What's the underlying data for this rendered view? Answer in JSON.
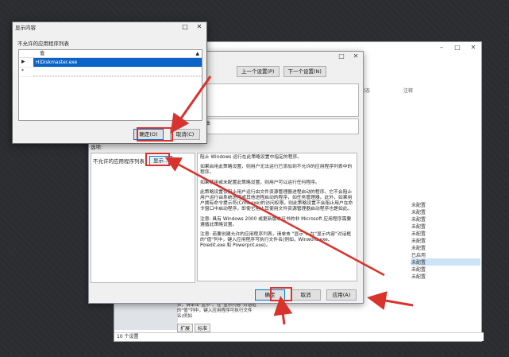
{
  "background_window": {
    "title_controls": [
      "–",
      "□",
      "✕"
    ],
    "columns": [
      "状态",
      "注释"
    ],
    "status_values": [
      "未配置",
      "未配置",
      "未配置",
      "未配置",
      "未配置",
      "未配置",
      "未配置",
      "已启用",
      "未配置",
      "未配置",
      "未配置"
    ],
    "description_snippet": "表，请单击\"显示\"。在\"显示内容\"对话框的\"值\"列中，键入应用程序可执行文件名(例如",
    "tabs": [
      "扩展",
      "标准"
    ],
    "status_bar": "10 个设置"
  },
  "policy_dialog": {
    "title_controls": [
      "□",
      "✕"
    ],
    "prev_button": "上一个设置(P)",
    "next_button": "下一个设置(N)",
    "supported_partial": "本",
    "options_label": "选项:",
    "option_label": "不允许的应用程序列表",
    "show_button": "显示...",
    "help_paragraphs": [
      "阻止 Windows 运行在此策略设置中指定的程序。",
      "如果启用此策略设置，则用户无法运行已添加到不允许的应用程序列表中的程序。",
      "如果禁用或未配置此策略设置，则用户可以运行任何程序。",
      "此策略设置仅阻止用户运行由文件资源管理器进程启动的程序。它不会阻止用户运行由系统进程或其他进程启动的程序，如任务管理器。此外，如果用户拥有命令提示符(Cmd.exe)的访问权限，则此策略设置不会阻止用户在命令窗口中启动程序，即使它阻止其使用文件资源管理器启动程序也是如此。",
      "注意: 具有 Windows 2000 或更新版本证书的非 Microsoft 应用程序需要遵循此策略设置。",
      "注意: 若要创建允许的应用程序列表，请单击 \"显示\"。在\"显示内容\"对话框的\"值\"列中，键入应用程序可执行文件名(例如，Winword.exe、Poledit.exe 和 Powerpnt.exe)。"
    ],
    "ok": "确定",
    "cancel": "取消",
    "apply": "应用(A)"
  },
  "show_dialog": {
    "title": "显示内容",
    "title_controls": [
      "□",
      "✕"
    ],
    "list_label": "不允许的应用程序列表",
    "column": "值",
    "header_arrow": "▲",
    "rows": [
      {
        "marker": "▶",
        "value": "HiDiskmaster.exe",
        "selected": true
      },
      {
        "marker": "*",
        "value": "",
        "selected": false
      }
    ],
    "ok": "确定(O)",
    "cancel": "取消(C)"
  },
  "colors": {
    "annotation": "#d9332d",
    "selection": "#0a64c8",
    "accent": "#0078d7"
  }
}
